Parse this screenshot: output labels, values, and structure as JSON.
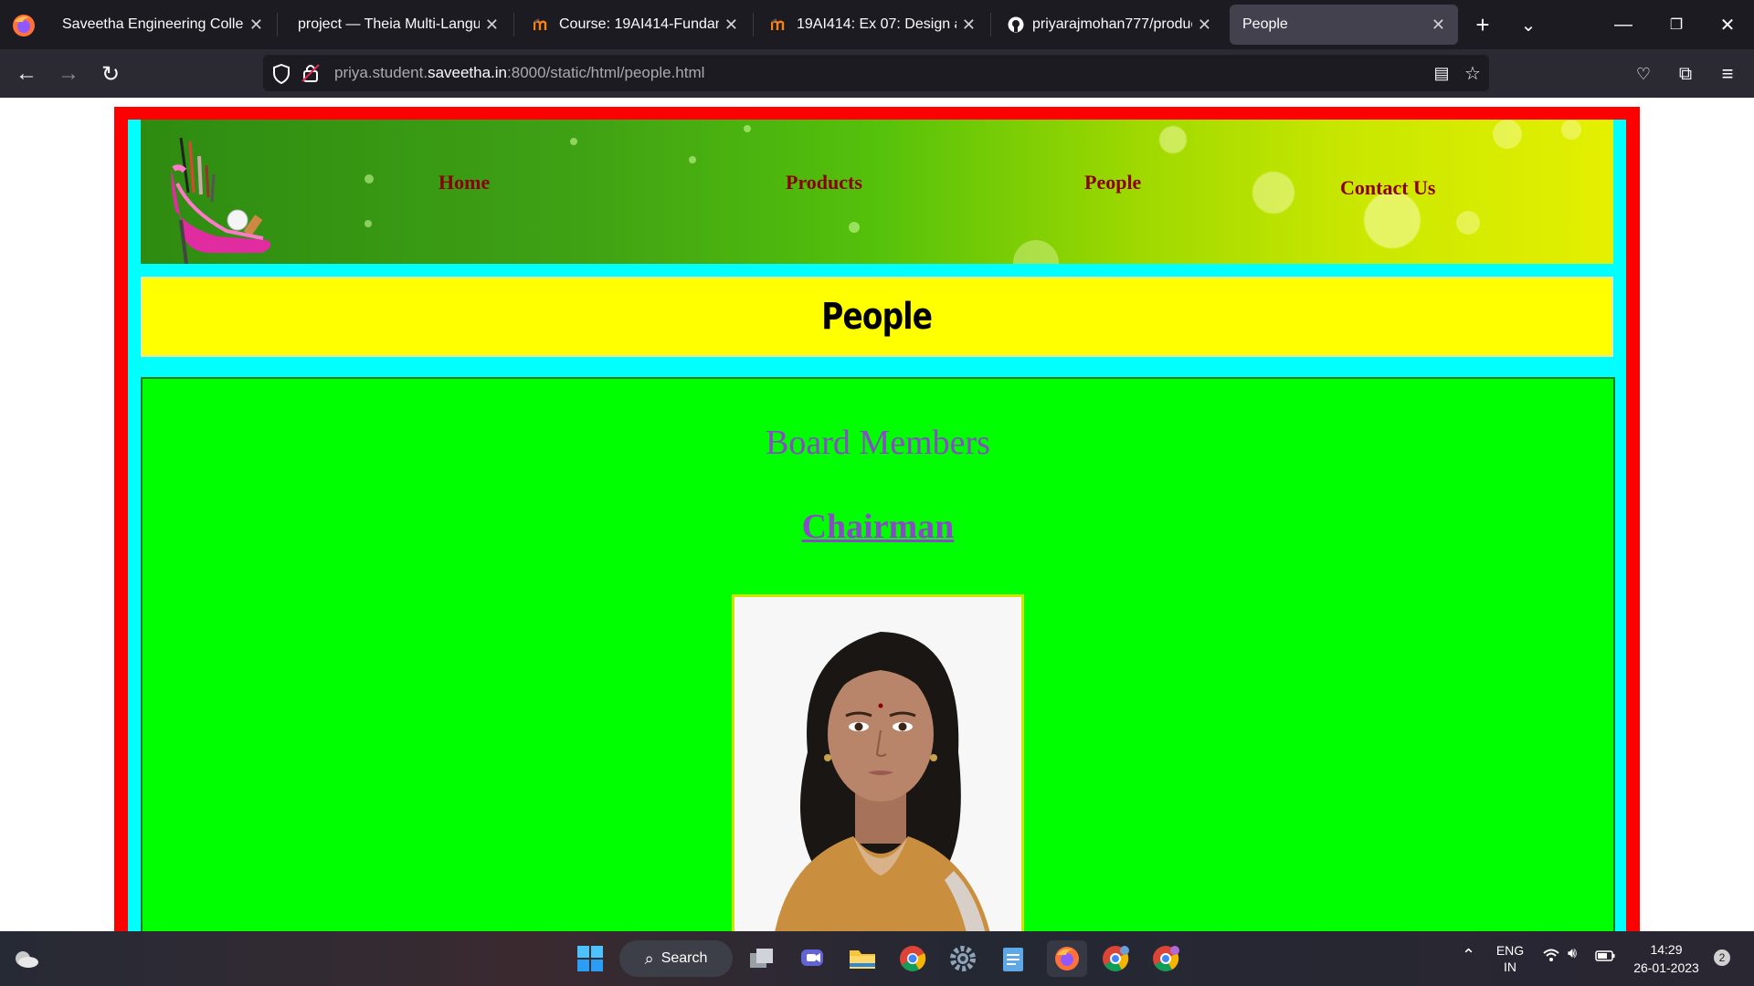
{
  "browser": {
    "tabs": [
      {
        "title": "Saveetha Engineering College",
        "favicon": "college-favicon"
      },
      {
        "title": "project — Theia Multi-Language",
        "favicon": "none"
      },
      {
        "title": "Course: 19AI414-Fundamentals",
        "favicon": "moodle-favicon"
      },
      {
        "title": "19AI414: Ex 07: Design a We",
        "favicon": "moodle-favicon"
      },
      {
        "title": "priyarajmohan777/productw",
        "favicon": "github-icon"
      },
      {
        "title": "People",
        "favicon": "none",
        "active": true
      }
    ],
    "url_prefix": "priya.student.",
    "url_host": "saveetha.in",
    "url_suffix": ":8000/static/html/people.html"
  },
  "site": {
    "nav": [
      "Home",
      "Products",
      "People",
      "Contact Us"
    ],
    "page_title": "People",
    "section_title": "Board Members",
    "role_title": "Chairman"
  },
  "taskbar": {
    "search_label": "Search",
    "lang_top": "ENG",
    "lang_bottom": "IN",
    "time": "14:29",
    "date": "26-01-2023",
    "notification_count": "2"
  },
  "colors": {
    "frame": "#ff0000",
    "inner": "#00ffff",
    "title_bar": "#ffff00",
    "content": "#00ff00",
    "nav_link": "#8b0000",
    "heading": "#8a4ac8"
  }
}
